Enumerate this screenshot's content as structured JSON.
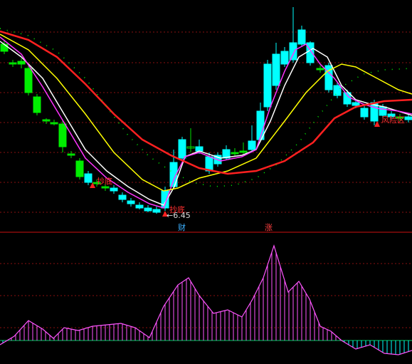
{
  "chart_data": [
    {
      "type": "candlestick",
      "title": "",
      "price_label": "←6.45",
      "markers": [
        {
          "text": "抄底",
          "series": "buy"
        },
        {
          "text": "抄底",
          "series": "buy"
        },
        {
          "text": "风险区",
          "series": "sell"
        }
      ],
      "badges": [
        {
          "text": "财",
          "color": "#3bb0ff"
        },
        {
          "text": "涨",
          "color": "#ff4040"
        }
      ],
      "overlays": [
        {
          "color": "#ffffff"
        },
        {
          "color": "#ff33ff"
        },
        {
          "color": "#ffff00"
        },
        {
          "color": "#ff2020"
        },
        {
          "color": "#00ff00",
          "style": "dotted"
        }
      ],
      "up_color": "#ff3030",
      "down_color": "#00ffff",
      "flat_color": "#00e000",
      "grid": true
    },
    {
      "type": "bar",
      "pos_color": "#ff55ff",
      "neg_color": "#00ffff",
      "zero_color": "#00cc66",
      "grid": true
    }
  ]
}
